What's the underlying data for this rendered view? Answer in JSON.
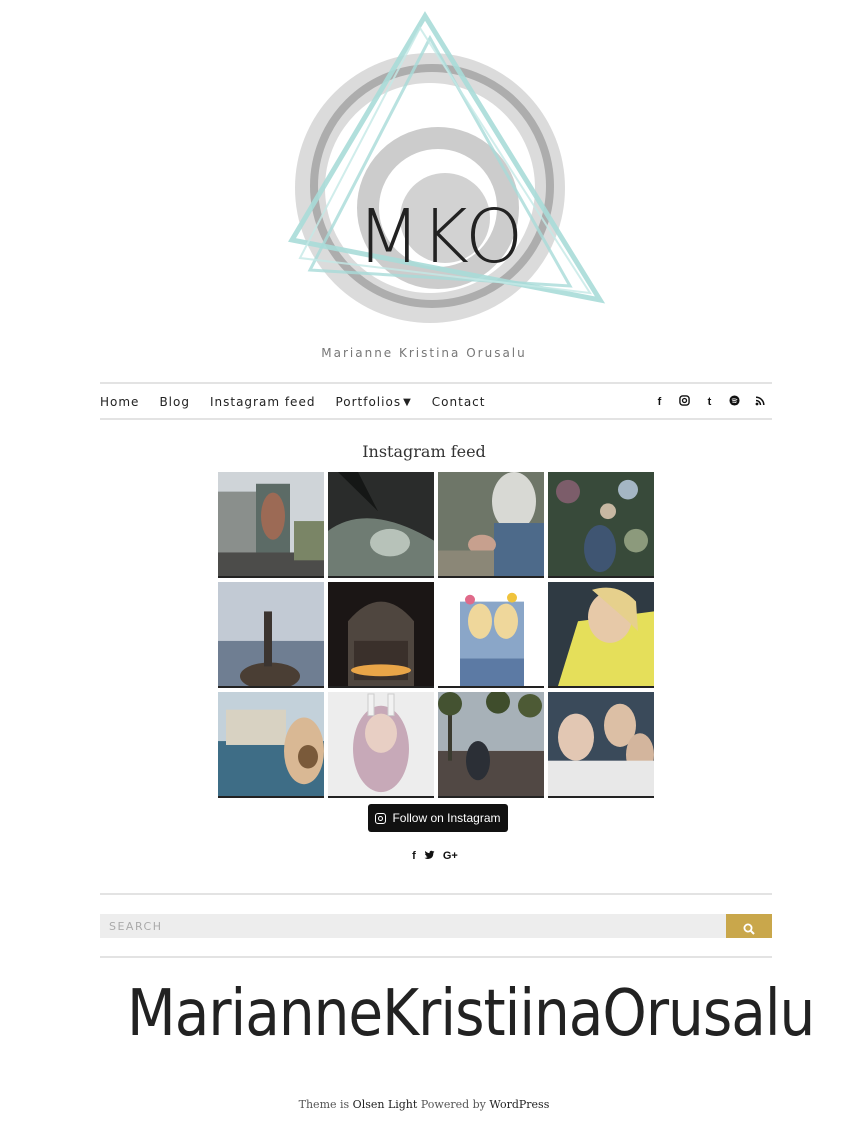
{
  "site": {
    "logo_text": "MKO",
    "tagline": "Marianne Kristina Orusalu"
  },
  "nav": {
    "items": [
      {
        "label": "Home"
      },
      {
        "label": "Blog"
      },
      {
        "label": "Instagram feed"
      },
      {
        "label": "Portfolios",
        "has_submenu": true
      },
      {
        "label": "Contact"
      }
    ],
    "social_icons": [
      "facebook-icon",
      "instagram-icon",
      "tumblr-icon",
      "spotify-icon",
      "rss-icon"
    ]
  },
  "page": {
    "title": "Instagram feed"
  },
  "instagram": {
    "photo_count": 12,
    "follow_label": "Follow on Instagram"
  },
  "share_icons": [
    "facebook-icon",
    "twitter-icon",
    "google-plus-icon"
  ],
  "search": {
    "placeholder": "SEARCH"
  },
  "footer": {
    "signature_text": "MarianneKristiinaOrusalu",
    "credit_prefix": "Theme is",
    "theme_name": "Olsen Light",
    "powered_by_text": "Powered by",
    "platform_name": "WordPress"
  },
  "colors": {
    "accent_gold": "#c9a74b",
    "logo_teal": "#a8dbd8",
    "divider": "#e3e3e3"
  }
}
